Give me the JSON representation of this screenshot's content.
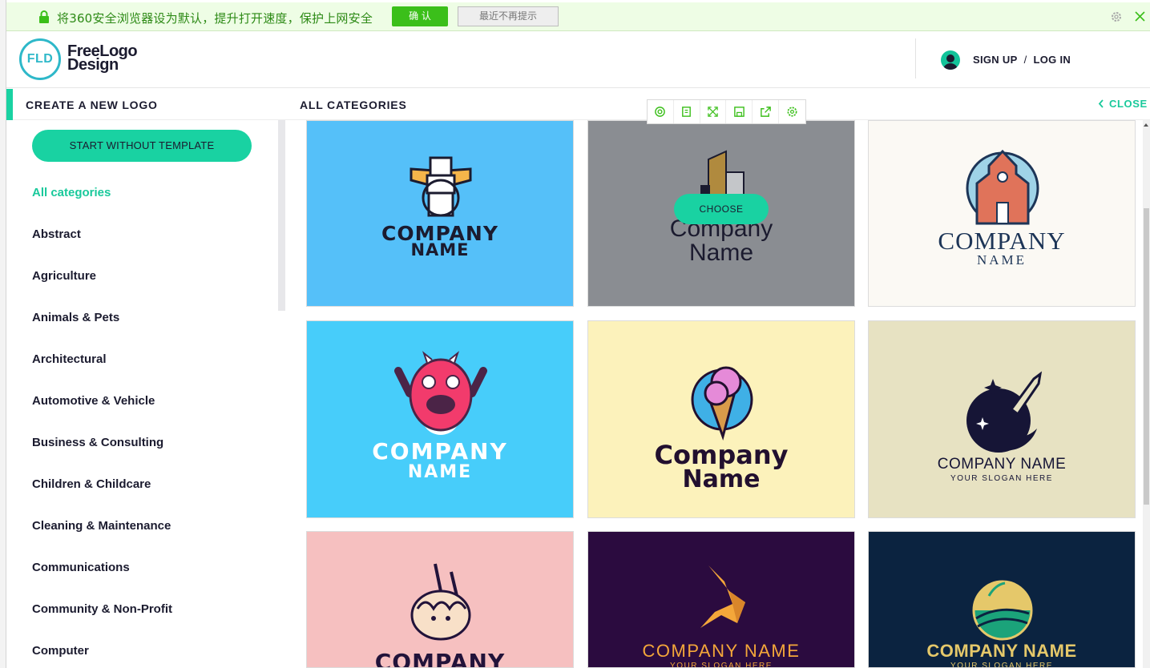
{
  "browser_notice": {
    "message": "将360安全浏览器设为默认，提升打开速度，保护上网安全",
    "confirm_label": "确 认",
    "dismiss_label": "最近不再提示"
  },
  "header": {
    "logo_badge": "FLD",
    "logo_line1": "FreeLogo",
    "logo_line2": "Design",
    "signup_label": "SIGN UP",
    "separator": "/",
    "login_label": "LOG IN"
  },
  "subheader": {
    "create_label": "CREATE A NEW LOGO",
    "section_title": "ALL CATEGORIES",
    "close_label": "CLOSE"
  },
  "toolbar": {
    "icons": [
      "search-icon",
      "copy-icon",
      "fullscreen-icon",
      "save-icon",
      "share-icon",
      "settings-icon"
    ]
  },
  "sidebar": {
    "start_button": "START WITHOUT TEMPLATE",
    "categories": [
      "All categories",
      "Abstract",
      "Agriculture",
      "Animals & Pets",
      "Architectural",
      "Automotive & Vehicle",
      "Business & Consulting",
      "Children & Childcare",
      "Cleaning & Maintenance",
      "Communications",
      "Community & Non-Profit",
      "Computer"
    ],
    "active_category": "All categories"
  },
  "grid": {
    "choose_label": "CHOOSE",
    "cards": [
      {
        "bg": "#55c0f9",
        "line1": "COMPANY",
        "line2": "NAME",
        "icon": "totem-icon"
      },
      {
        "bg": "#8a8d92",
        "line1": "Company",
        "line2": "Name",
        "icon": "building-icon"
      },
      {
        "bg": "#fbf9f4",
        "line1": "COMPANY",
        "line2": "NAME",
        "icon": "church-icon"
      },
      {
        "bg": "#47cdfa",
        "line1": "COMPANY",
        "line2": "NAME",
        "icon": "monster-icon"
      },
      {
        "bg": "#fcf2bb",
        "line1": "Company",
        "line2": "Name",
        "icon": "ice-cream-icon"
      },
      {
        "bg": "#e7e2c2",
        "line1": "COMPANY NAME",
        "line2": "YOUR SLOGAN HERE",
        "icon": "rocket-icon"
      },
      {
        "bg": "#f6c0c0",
        "line1": "COMPANY",
        "line2": "",
        "icon": "noodles-icon"
      },
      {
        "bg": "#2b0b3f",
        "line1": "COMPANY NAME",
        "line2": "YOUR SLOGAN HERE",
        "icon": "origami-bird-icon"
      },
      {
        "bg": "#0b2340",
        "line1": "COMPANY NAME",
        "line2": "YOUR SLOGAN HERE",
        "icon": "farm-field-icon"
      }
    ]
  }
}
